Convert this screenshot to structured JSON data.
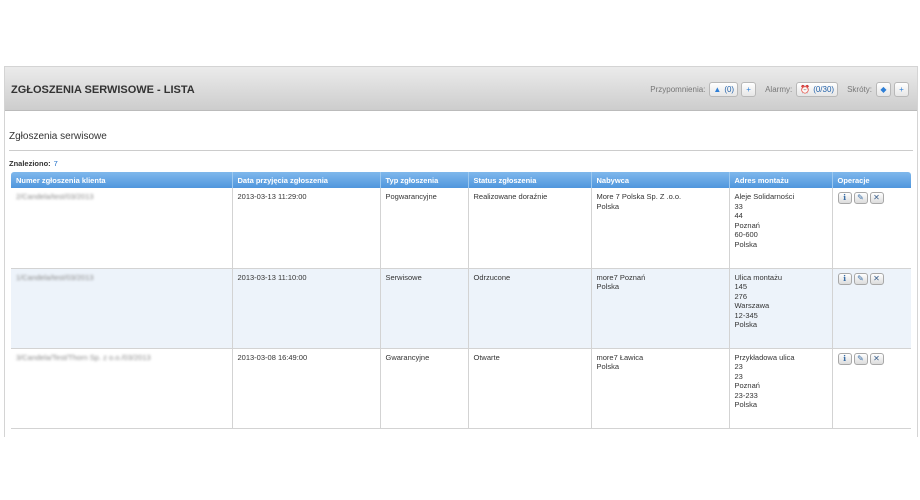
{
  "header": {
    "title": "ZGŁOSZENIA SERWISOWE - LISTA",
    "reminders_label": "Przypomnienia:",
    "reminders_count": "(0)",
    "alarms_label": "Alarmy:",
    "alarms_count": "(0/30)",
    "shortcuts_label": "Skróty:"
  },
  "section": {
    "title": "Zgłoszenia serwisowe",
    "found_label": "Znaleziono:",
    "found_count": "7"
  },
  "table": {
    "columns": [
      "Numer zgłoszenia klienta",
      "Data przyjęcia zgłoszenia",
      "Typ zgłoszenia",
      "Status zgłoszenia",
      "Nabywca",
      "Adres montażu",
      "Operacje"
    ],
    "rows": [
      {
        "number": "2/Candela/test/03/2013",
        "date": "2013-03-13 11:29:00",
        "type": "Pogwarancyjne",
        "status": "Realizowane doraźnie",
        "buyer": [
          "More 7 Polska Sp. Z .o.o.",
          "Polska"
        ],
        "address": [
          "Aleje Solidarności",
          "33",
          "44",
          "Poznań",
          "60-600",
          "Polska"
        ]
      },
      {
        "number": "1/Candela/test/03/2013",
        "date": "2013-03-13 11:10:00",
        "type": "Serwisowe",
        "status": "Odrzucone",
        "buyer": [
          "more7 Poznań",
          "Polska"
        ],
        "address": [
          "Ulica montażu",
          "145",
          "276",
          "Warszawa",
          "12-345",
          "Polska"
        ]
      },
      {
        "number": "3/Candela/Test/Thorn Sp. z o.o./03/2013",
        "date": "2013-03-08 16:49:00",
        "type": "Gwarancyjne",
        "status": "Otwarte",
        "buyer": [
          "more7 Ławica",
          "Polska"
        ],
        "address": [
          "Przykładowa ulica",
          "23",
          "23",
          "Poznań",
          "23-233",
          "Polska"
        ]
      }
    ]
  },
  "icons": {
    "reminder": "bell-icon",
    "alarm": "alarm-clock-icon",
    "shortcut": "bookmark-icon",
    "add": "plus-icon",
    "info": "info-icon",
    "edit": "pencil-icon",
    "delete": "close-icon"
  },
  "colors": {
    "header_blue": "#4f96dd",
    "link_blue": "#1f6fc8",
    "row_alt": "#edf3fa"
  }
}
